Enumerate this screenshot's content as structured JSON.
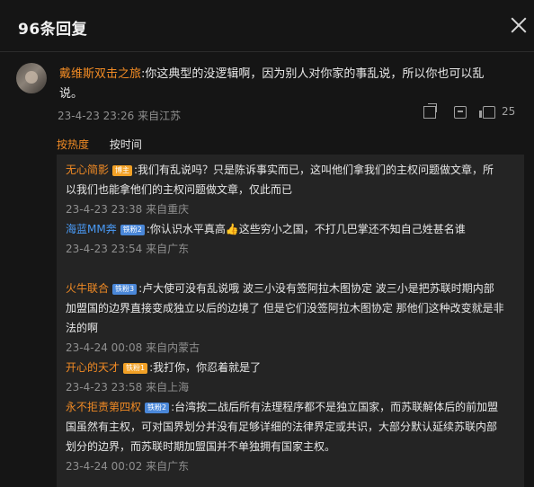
{
  "header": {
    "title": "96条回复"
  },
  "main_comment": {
    "username": "戴维斯双击之旅",
    "text": ":你这典型的没逻辑啊，因为别人对你家的事乱说，所以你也可以乱说。",
    "time": "23-4-23 23:26",
    "location": "来自江苏",
    "likes": "25"
  },
  "sort_tabs": {
    "hot": "按热度",
    "time": "按时间"
  },
  "replies": [
    {
      "username": "无心简影",
      "badge": "博主",
      "text": ":我们有乱说吗？只是陈诉事实而已，这叫他们拿我们的主权问题做文章，所以我们也能拿他们的主权问题做文章，仅此而已",
      "time": "23-4-23 23:38",
      "location": "来自重庆"
    },
    {
      "username": "海蓝MM奔",
      "badge": "铁粉2",
      "text": ":你认识水平真高👍这些穷小之国，不打几巴掌还不知自己姓甚名谁",
      "time": "23-4-23 23:54",
      "location": "来自广东"
    },
    {
      "username": "火牛联合",
      "badge": "铁粉3",
      "text": ":卢大使可没有乱说哦  波三小没有签阿拉木图协定  波三小是把苏联时期内部加盟国的边界直接变成独立以后的边境了  但是它们没签阿拉木图协定  那他们这种改变就是非法的啊",
      "time": "23-4-24 00:08",
      "location": "来自内蒙古"
    },
    {
      "username": "开心的天才",
      "badge": "铁粉1",
      "text": ":我打你，你忍着就是了",
      "time": "23-4-23 23:58",
      "location": "来自上海"
    },
    {
      "username": "永不拒责第四权",
      "badge": "铁粉2",
      "text": ":台湾按二战后所有法理程序都不是独立国家，而苏联解体后的前加盟国虽然有主权，可对国界划分并没有足够详细的法律界定或共识，大部分默认延续苏联内部划分的边界，而苏联时期加盟国并不单独拥有国家主权。",
      "time": "23-4-24 00:02",
      "location": "来自广东"
    }
  ],
  "colors": {
    "accent": "#f08a24",
    "badge_orange": "#f2a126",
    "badge_blue": "#4a87d8",
    "background": "#151515",
    "reply_background": "#242424"
  },
  "icons": {
    "share": "share-icon",
    "comment": "comment-icon",
    "like": "thumb-up-icon",
    "close": "close-icon"
  }
}
